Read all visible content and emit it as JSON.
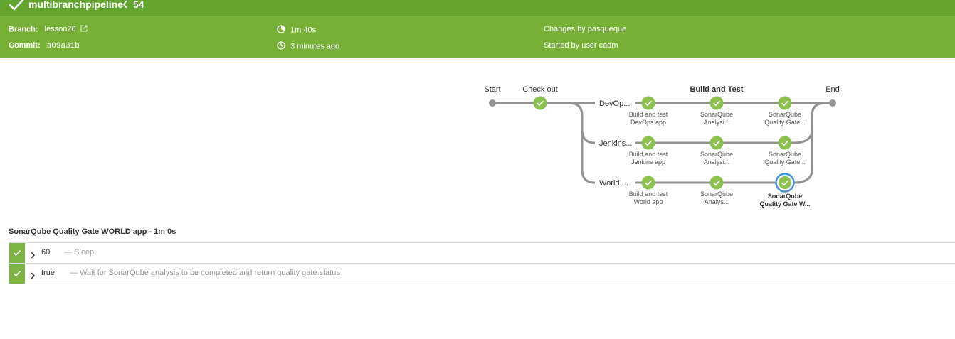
{
  "header": {
    "pipeline_name": "multibranchpipeline",
    "run_number": "54",
    "accent_color": "#63a42e",
    "meta_color": "#78b037"
  },
  "meta": {
    "branch_label": "Branch:",
    "branch_value": "lesson26",
    "commit_label": "Commit:",
    "commit_value": "a09a31b",
    "duration": "1m 40s",
    "time_ago": "3 minutes ago",
    "changes": "Changes by pasqueque",
    "started_by": "Started by user cadm"
  },
  "graph": {
    "start_label": "Start",
    "checkout_label": "Check out",
    "build_test_label": "Build and Test",
    "end_label": "End",
    "branches": [
      {
        "name": "DevOp...",
        "steps": [
          {
            "line1": "Build and test",
            "line2": "DevOps app"
          },
          {
            "line1": "SonarQube",
            "line2": "Analysi..."
          },
          {
            "line1": "SonarQube",
            "line2": "Quality Gate..."
          }
        ]
      },
      {
        "name": "Jenkins...",
        "steps": [
          {
            "line1": "Build and test",
            "line2": "Jenkins app"
          },
          {
            "line1": "SonarQube",
            "line2": "Analysi..."
          },
          {
            "line1": "SonarQube",
            "line2": "Quality Gate..."
          }
        ]
      },
      {
        "name": "World ...",
        "steps": [
          {
            "line1": "Build and test",
            "line2": "World app"
          },
          {
            "line1": "SonarQube",
            "line2": "Analys..."
          },
          {
            "line1": "SonarQube",
            "line2": "Quality Gate W..."
          }
        ]
      }
    ],
    "success_color": "#8cc04f",
    "selected_ring_color": "#4a90d9"
  },
  "selected_stage": {
    "title": "SonarQube Quality Gate WORLD app - 1m 0s"
  },
  "steps": [
    {
      "arg": "60",
      "desc": "— Sleep"
    },
    {
      "arg": "true",
      "desc": "— Wait for SonarQube analysis to be completed and return quality gate status"
    }
  ]
}
